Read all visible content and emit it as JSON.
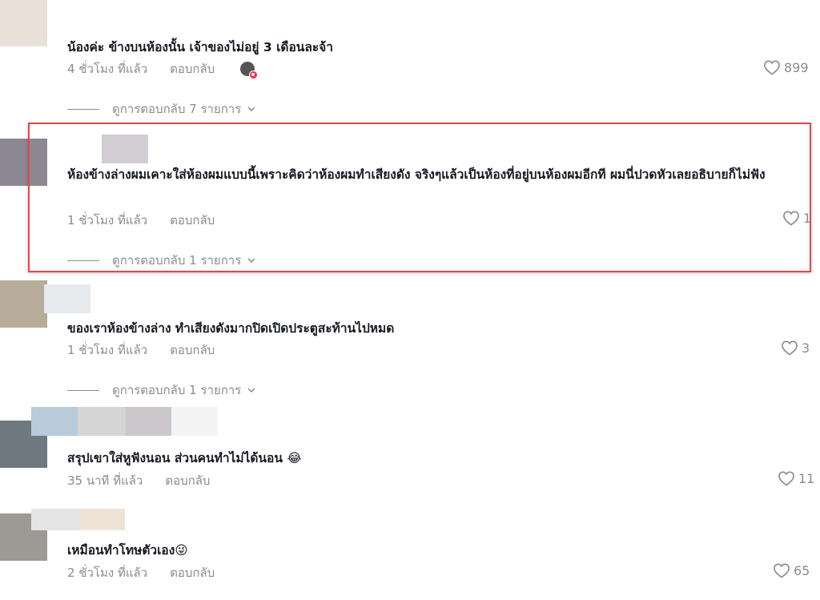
{
  "colors": {
    "accent_red": "#fe2c55",
    "highlight_border": "#e0484c",
    "meta_gray": "#8a8b91",
    "text": "#161823"
  },
  "comments": [
    {
      "text": "น้องค่ะ ข้างบนห้องนั้น เจ้าของไม่อยู่ 3 เดือนละจ้า",
      "time": "4 ชั่วโมง ที่แล้ว",
      "reply": "ตอบกลับ",
      "likes": "899",
      "view_replies": "ดูการตอบกลับ 7 รายการ"
    },
    {
      "text": "ห้องข้างล่างผมเคาะใส่ห้องผมแบบนี้เพราะคิดว่าห้องผมทำเสียงดัง จริงๆแล้วเป็นห้องที่อยู่บนห้องผมอีกที ผมนี่ปวดหัวเลยอธิบายก็ไม่ฟัง",
      "time": "1 ชั่วโมง ที่แล้ว",
      "reply": "ตอบกลับ",
      "likes": "1",
      "view_replies": "ดูการตอบกลับ 1 รายการ"
    },
    {
      "text": "ของเราห้องข้างล่าง ทำเสียงดังมากปิดเปิดประตูสะท้านไปหมด",
      "time": "1 ชั่วโมง ที่แล้ว",
      "reply": "ตอบกลับ",
      "likes": "3",
      "view_replies": "ดูการตอบกลับ 1 รายการ"
    },
    {
      "text": "สรุปเขาใส่หูฟังนอน ส่วนคนทำไม่ได้นอน 😂",
      "time": "35 นาที ที่แล้ว",
      "reply": "ตอบกลับ",
      "likes": "11"
    },
    {
      "text": "เหมือนทำโทษตัวเอง😜",
      "time": "2 ชั่วโมง ที่แล้ว",
      "reply": "ตอบกลับ",
      "likes": "65"
    }
  ]
}
